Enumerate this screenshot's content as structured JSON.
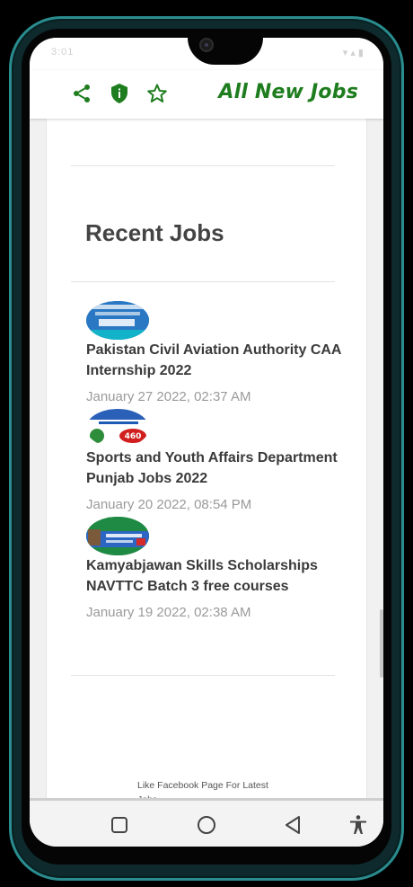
{
  "status_bar": {
    "left": "3:01",
    "right": ""
  },
  "header": {
    "title": "All New Jobs",
    "icons": [
      "share-icon",
      "shield-info-icon",
      "star-icon"
    ],
    "accent_color": "#1e7d1e"
  },
  "recent_jobs": {
    "title": "Recent Jobs",
    "items": [
      {
        "title": "Pakistan Civil Aviation Authority CAA Internship 2022",
        "date": "January 27 2022, 02:37 AM"
      },
      {
        "title": "Sports and Youth Affairs Department Punjab Jobs 2022",
        "date": "January 20 2022, 08:54 PM"
      },
      {
        "title": "Kamyabjawan Skills Scholarships NAVTTC Batch 3 free courses",
        "date": "January 19 2022, 02:38 AM"
      }
    ]
  },
  "footer": {
    "facebook_text": "Like Facebook Page For Latest Jobs"
  },
  "nav": {
    "buttons": [
      "recents-square-icon",
      "home-circle-icon",
      "back-triangle-icon",
      "accessibility-icon"
    ]
  }
}
